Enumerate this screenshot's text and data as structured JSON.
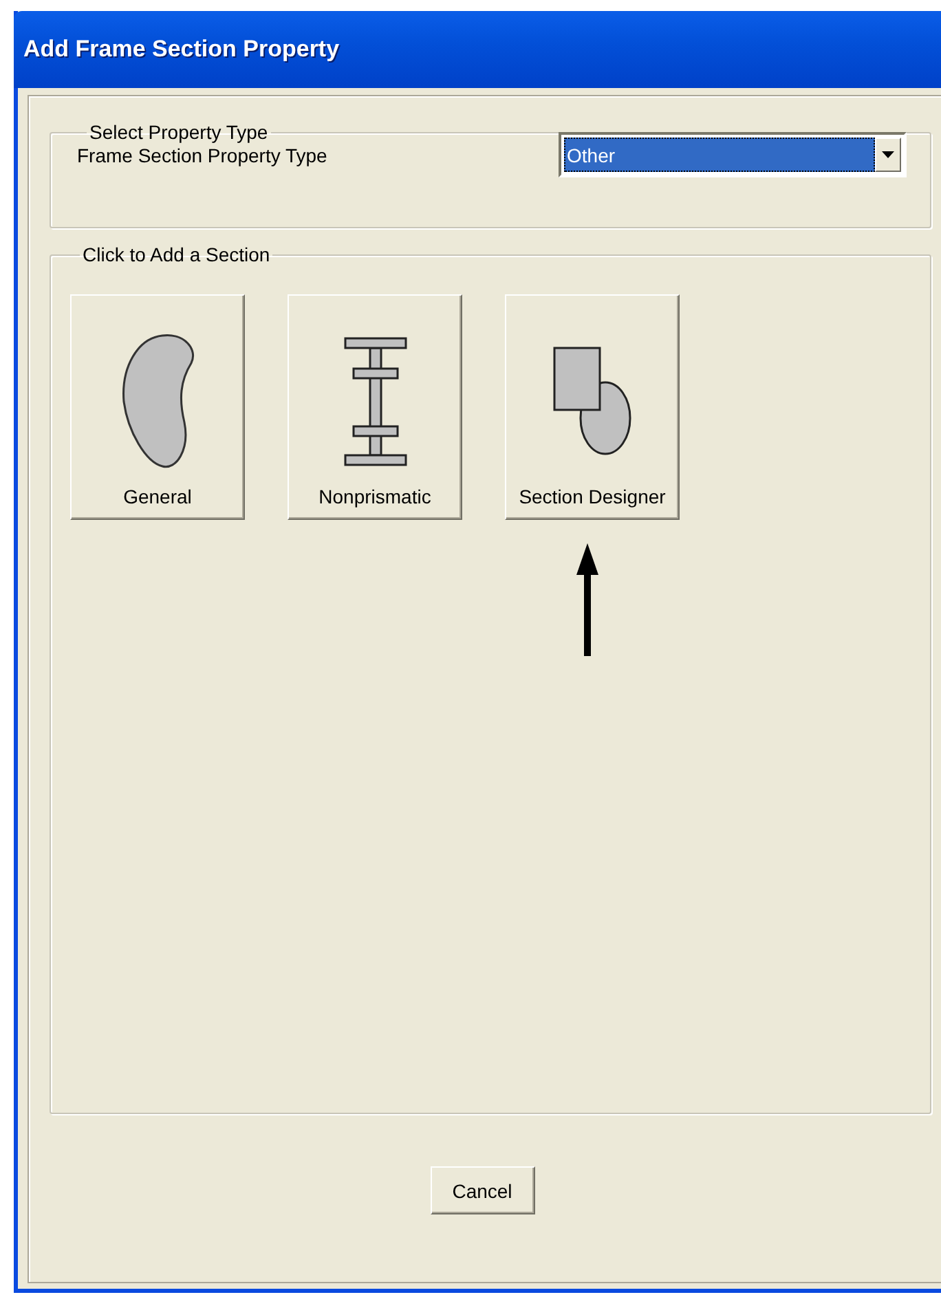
{
  "window": {
    "title": "Add Frame Section Property"
  },
  "property_type_group": {
    "title": "Select Property Type",
    "label": "Frame Section Property Type",
    "dropdown": {
      "value": "Other"
    }
  },
  "add_section_group": {
    "title": "Click to Add a Section",
    "buttons": [
      {
        "kind": "general",
        "label": "General"
      },
      {
        "kind": "nonprismatic",
        "label": "Nonprismatic"
      },
      {
        "kind": "designer",
        "label": "Section Designer"
      }
    ]
  },
  "buttons": [
    "Cancel"
  ]
}
